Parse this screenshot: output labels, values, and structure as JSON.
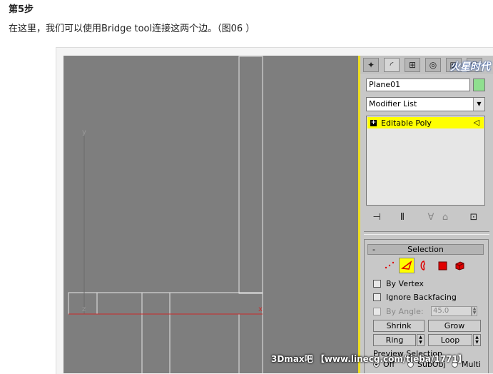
{
  "article": {
    "step_title": "第5步",
    "step_desc": "在这里，我们可以使用Bridge tool连接这两个边。（图06 ）"
  },
  "viewport": {
    "axis_y": "y",
    "axis_z": "z",
    "axis_x": "x",
    "background_color": "#7e7e7e",
    "active_border_color": "#f0e020"
  },
  "command_panel": {
    "tabs": [
      "create-icon",
      "modify-icon",
      "hierarchy-icon",
      "motion-icon",
      "display-icon",
      "utilities-icon"
    ],
    "logo_text": "火星时代",
    "object_name": "Plane01",
    "object_color": "#8fdf8f",
    "modifier_list": "Modifier List",
    "stack_item": "Editable Poly",
    "stack_tools": [
      "pin-stack-icon",
      "show-end-result-icon",
      "make-unique-icon",
      "remove-modifier-icon",
      "configure-modifier-sets-icon"
    ]
  },
  "selection_rollout": {
    "minus": "-",
    "title": "Selection",
    "subobject_icons": [
      "vertex-icon",
      "edge-icon",
      "border-icon",
      "polygon-icon",
      "element-icon"
    ],
    "by_vertex": "By Vertex",
    "ignore_backfacing": "Ignore Backfacing",
    "by_angle": "By Angle:",
    "angle_value": "45.0",
    "shrink": "Shrink",
    "grow": "Grow",
    "ring": "Ring",
    "loop": "Loop",
    "preview_selection": "Preview Selection",
    "preview_off": "Off",
    "preview_subobj": "SubObj",
    "preview_multi": "Multi"
  },
  "watermark": "3Dmax吧 【www.linecg.com/tieba/1771】"
}
